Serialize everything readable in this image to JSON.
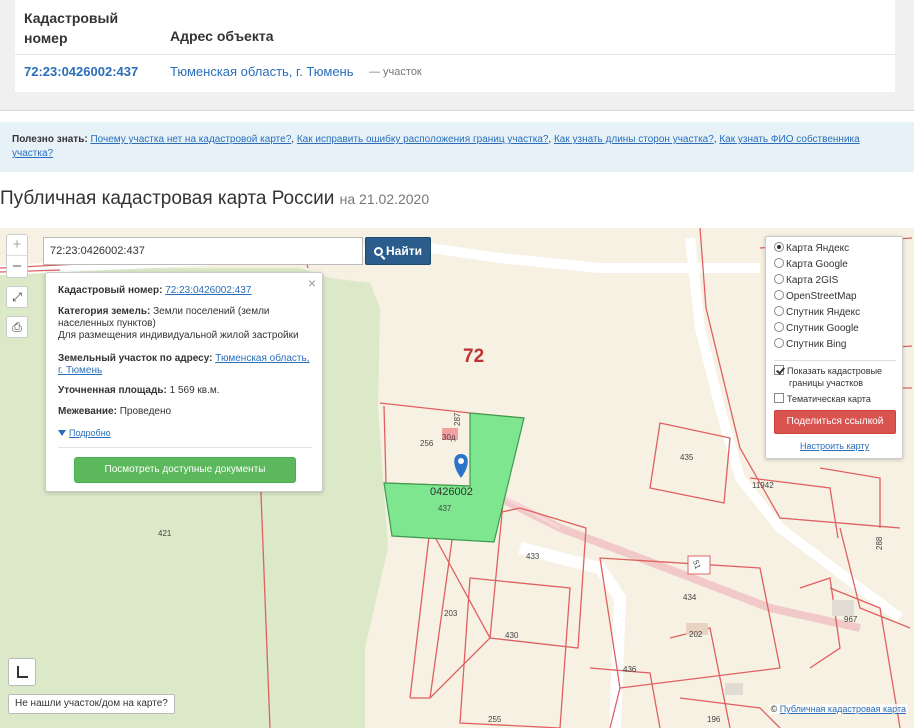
{
  "table": {
    "col_number": "Кадастровый номер",
    "col_address": "Адрес объекта",
    "row": {
      "number": "72:23:0426002:437",
      "address": "Тюменская область, г. Тюмень",
      "type": "— участок"
    }
  },
  "info": {
    "prefix": "Полезно знать:",
    "links": [
      "Почему участка нет на кадастровой карте?",
      "Как исправить ошибку расположения границ участка?",
      "Как узнать длины сторон участка?",
      "Как узнать ФИО собственника участка?"
    ]
  },
  "heading": {
    "title": "Публичная кадастровая карта России",
    "date": "на 21.02.2020"
  },
  "map": {
    "search_value": "72:23:0426002:437",
    "search_button": "Найти",
    "zoom_in": "+",
    "zoom_out": "–",
    "popup": {
      "cad_label": "Кадастровый номер:",
      "cad_value": "72:23:0426002:437",
      "category_label": "Категория земель:",
      "category_value": "Земли поселений (земли населенных пунктов)",
      "use_value": "Для размещения индивидуальной жилой застройки",
      "address_label": "Земельный участок по адресу:",
      "address_value": "Тюменская область, г. Тюмень",
      "area_label": "Уточненная площадь:",
      "area_value": "1 569 кв.м.",
      "survey_label": "Межевание:",
      "survey_value": "Проведено",
      "more": "Подробно",
      "docs_button": "Посмотреть доступные документы",
      "close": "×"
    },
    "layers": {
      "options": [
        "Карта Яндекс",
        "Карта Google",
        "Карта 2GIS",
        "OpenStreetMap",
        "Спутник Яндекс",
        "Спутник Google",
        "Спутник Bing"
      ],
      "selected": 0,
      "show_borders_line1": "Показать кадастровые",
      "show_borders_line2": "границы участков",
      "thematic": "Тематическая карта",
      "share_button": "Поделиться ссылкой",
      "tune_link": "Настроить карту"
    },
    "not_found": "Не нашли участок/дом на карте?",
    "attribution_prefix": "©",
    "attribution_link": "Публичная кадастровая карта",
    "labels": {
      "quarter": "72",
      "selected_parcel": "0426002",
      "p437": "437",
      "p256": "256",
      "p287": "287",
      "p30d": "30д",
      "p435": "435",
      "p11942": "11942",
      "p421": "421",
      "p433": "433",
      "p434": "434",
      "p203": "203",
      "p430": "430",
      "p202": "202",
      "p436": "436",
      "p255": "255",
      "p196": "196",
      "p288": "288",
      "p967": "967",
      "p51": "51"
    }
  }
}
